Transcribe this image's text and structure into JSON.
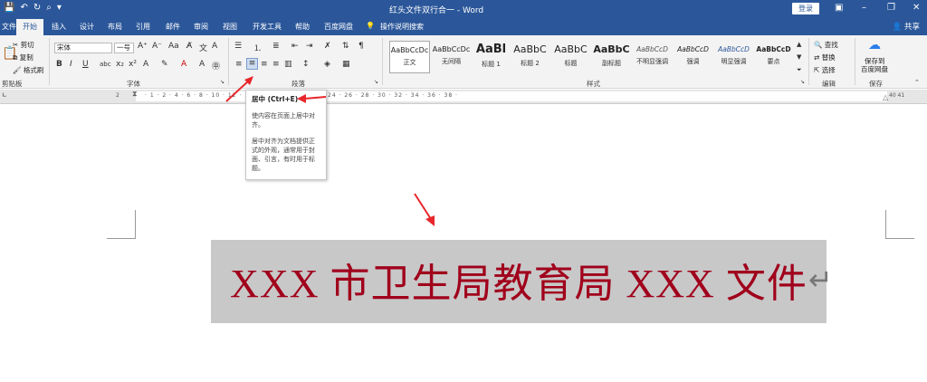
{
  "window": {
    "title": "红头文件双行合一 - Word",
    "login_label": "登录",
    "share_label": "共享"
  },
  "tabs": [
    {
      "label": "文件"
    },
    {
      "label": "开始"
    },
    {
      "label": "插入"
    },
    {
      "label": "设计"
    },
    {
      "label": "布局"
    },
    {
      "label": "引用"
    },
    {
      "label": "邮件"
    },
    {
      "label": "审阅"
    },
    {
      "label": "视图"
    },
    {
      "label": "开发工具"
    },
    {
      "label": "帮助"
    },
    {
      "label": "百度网盘"
    },
    {
      "label": "操作说明搜索"
    }
  ],
  "clipboard": {
    "cut": "剪切",
    "copy": "复制",
    "painter": "格式刷",
    "label": "剪贴板"
  },
  "font": {
    "name": "宋体",
    "size": "一号",
    "label": "字体"
  },
  "paragraph": {
    "label": "段落"
  },
  "styles": {
    "label": "样式",
    "items": [
      {
        "sample": "AaBbCcDc",
        "name": "正文"
      },
      {
        "sample": "AaBbCcDc",
        "name": "无间隔"
      },
      {
        "sample": "AaBl",
        "name": "标题 1"
      },
      {
        "sample": "AaBbC",
        "name": "标题 2"
      },
      {
        "sample": "AaBbC",
        "name": "标题"
      },
      {
        "sample": "AaBbC",
        "name": "副标题"
      },
      {
        "sample": "AaBbCcD",
        "name": "不明显强调"
      },
      {
        "sample": "AaBbCcD",
        "name": "强调"
      },
      {
        "sample": "AaBbCcD",
        "name": "明显强调"
      },
      {
        "sample": "AaBbCcD",
        "name": "要点"
      }
    ]
  },
  "editing": {
    "find": "查找",
    "replace": "替换",
    "select": "选择",
    "label": "编辑"
  },
  "save": {
    "line1": "保存到",
    "line2": "百度网盘",
    "label": "保存"
  },
  "ruler": {
    "left_num": "2",
    "right_nums": "40  41"
  },
  "tooltip": {
    "title": "居中 (Ctrl+E)",
    "text1": "使内容在页面上居中对齐。",
    "text2": "居中对齐为文档提供正式的外观，通常用于封面、引言，有时用于标题。"
  },
  "document": {
    "heading": "XXX 市卫生局教育局 XXX 文件"
  },
  "colors": {
    "accent": "#2b579a",
    "heading": "#a0001b",
    "arrow": "#e8262b"
  }
}
